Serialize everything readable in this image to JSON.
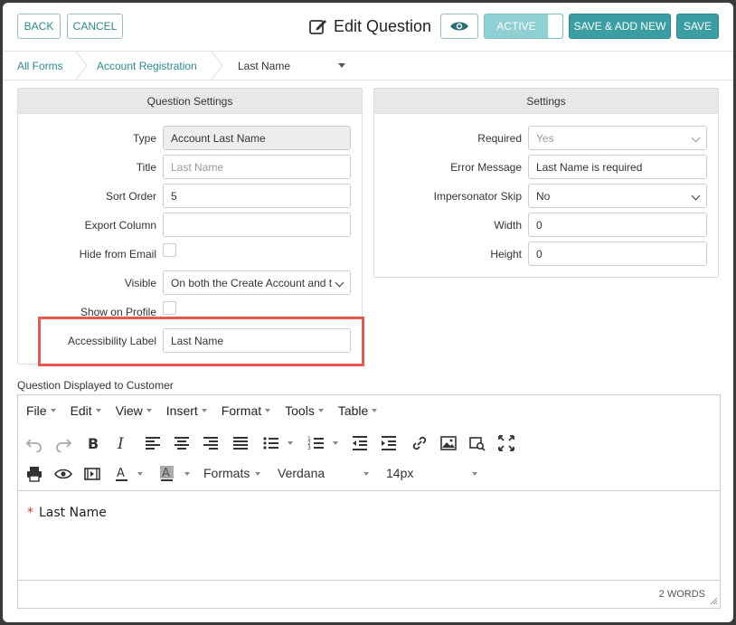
{
  "header": {
    "back_label": "BACK",
    "cancel_label": "CANCEL",
    "title": "Edit Question",
    "active_label": "ACTIVE",
    "save_add_new_label": "SAVE & ADD NEW",
    "save_label": "SAVE"
  },
  "breadcrumb": {
    "items": [
      "All Forms",
      "Account Registration",
      "Last Name"
    ]
  },
  "question_settings": {
    "title": "Question Settings",
    "type_label": "Type",
    "type_value": "Account Last Name",
    "title_label": "Title",
    "title_placeholder": "Last Name",
    "sort_order_label": "Sort Order",
    "sort_order_value": "5",
    "export_column_label": "Export Column",
    "export_column_value": "",
    "hide_from_email_label": "Hide from Email",
    "visible_label": "Visible",
    "visible_value": "On both the Create Account and t",
    "show_on_profile_label": "Show on Profile",
    "accessibility_label_label": "Accessibility Label",
    "accessibility_label_value": "Last Name"
  },
  "settings": {
    "title": "Settings",
    "required_label": "Required",
    "required_value": "Yes",
    "error_message_label": "Error Message",
    "error_message_value": "Last Name is required",
    "impersonator_skip_label": "Impersonator Skip",
    "impersonator_skip_value": "No",
    "width_label": "Width",
    "width_value": "0",
    "height_label": "Height",
    "height_value": "0"
  },
  "editor": {
    "label": "Question Displayed to Customer",
    "menu": [
      "File",
      "Edit",
      "View",
      "Insert",
      "Format",
      "Tools",
      "Table"
    ],
    "formats_label": "Formats",
    "font_family": "Verdana",
    "font_size": "14px",
    "required_marker": "*",
    "content": "Last Name",
    "word_count": "2 WORDS"
  },
  "colors": {
    "accent": "#3a9ea3",
    "highlight": "#e65a4e"
  }
}
